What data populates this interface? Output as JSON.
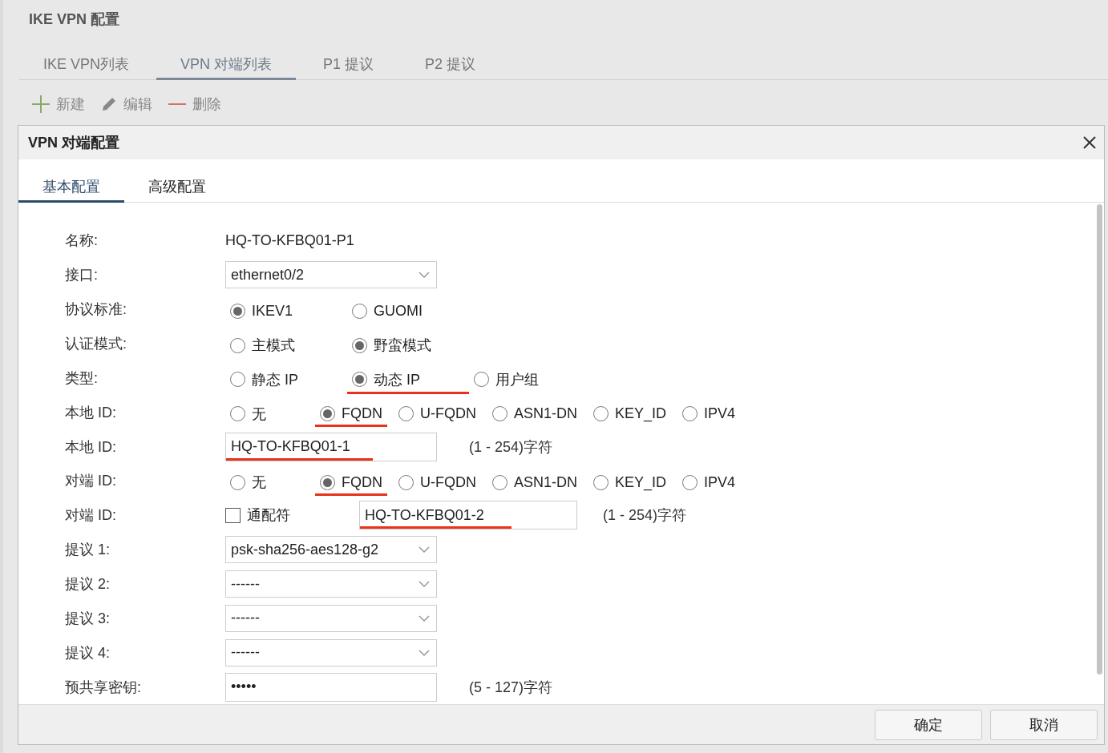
{
  "page_title": "IKE VPN 配置",
  "tabs": [
    {
      "label": "IKE VPN列表",
      "selected": false
    },
    {
      "label": "VPN 对端列表",
      "selected": true
    },
    {
      "label": "P1 提议",
      "selected": false
    },
    {
      "label": "P2 提议",
      "selected": false
    }
  ],
  "toolbar": [
    {
      "kind": "add",
      "label": "新建"
    },
    {
      "kind": "edit",
      "label": "编辑"
    },
    {
      "kind": "delete",
      "label": "删除"
    }
  ],
  "dialog": {
    "title": "VPN 对端配置",
    "tabs": [
      {
        "label": "基本配置",
        "selected": true
      },
      {
        "label": "高级配置",
        "selected": false
      }
    ],
    "rows": [
      {
        "kind": "text",
        "label": "名称:",
        "value": "HQ-TO-KFBQ01-P1"
      },
      {
        "kind": "select",
        "label": "接口:",
        "value": "ethernet0/2"
      },
      {
        "kind": "radio",
        "label": "协议标准:",
        "options": [
          {
            "label": "IKEV1",
            "selected": true,
            "highlighted": false
          },
          {
            "label": "GUOMI",
            "selected": false,
            "highlighted": false
          }
        ]
      },
      {
        "kind": "radio",
        "label": "认证模式:",
        "options": [
          {
            "label": "主模式",
            "selected": false,
            "highlighted": false
          },
          {
            "label": "野蛮模式",
            "selected": true,
            "highlighted": false
          }
        ]
      },
      {
        "kind": "radio",
        "label": "类型:",
        "options": [
          {
            "label": "静态 IP",
            "selected": false,
            "highlighted": false
          },
          {
            "label": "动态 IP",
            "selected": true,
            "highlighted": true
          },
          {
            "label": "用户组",
            "selected": false,
            "highlighted": false
          }
        ]
      },
      {
        "kind": "radio",
        "label": "本地 ID:",
        "options": [
          {
            "label": "无",
            "selected": false,
            "highlighted": false
          },
          {
            "label": "FQDN",
            "selected": true,
            "highlighted": true
          },
          {
            "label": "U-FQDN",
            "selected": false,
            "highlighted": false
          },
          {
            "label": "ASN1-DN",
            "selected": false,
            "highlighted": false
          },
          {
            "label": "KEY_ID",
            "selected": false,
            "highlighted": false
          },
          {
            "label": "IPV4",
            "selected": false,
            "highlighted": false
          }
        ]
      },
      {
        "kind": "input",
        "label": "本地 ID:",
        "value": "HQ-TO-KFBQ01-1",
        "highlighted": true,
        "hint": "(1 - 254)字符"
      },
      {
        "kind": "radio",
        "label": "对端 ID:",
        "options": [
          {
            "label": "无",
            "selected": false,
            "highlighted": false
          },
          {
            "label": "FQDN",
            "selected": true,
            "highlighted": true
          },
          {
            "label": "U-FQDN",
            "selected": false,
            "highlighted": false
          },
          {
            "label": "ASN1-DN",
            "selected": false,
            "highlighted": false
          },
          {
            "label": "KEY_ID",
            "selected": false,
            "highlighted": false
          },
          {
            "label": "IPV4",
            "selected": false,
            "highlighted": false
          }
        ]
      },
      {
        "kind": "wildcard",
        "label": "对端 ID:",
        "checkbox_label": "通配符",
        "checked": false,
        "value": "HQ-TO-KFBQ01-2",
        "highlighted": true,
        "hint": "(1 - 254)字符"
      },
      {
        "kind": "select",
        "label": "提议 1:",
        "value": "psk-sha256-aes128-g2"
      },
      {
        "kind": "select",
        "label": "提议 2:",
        "value": "------"
      },
      {
        "kind": "select",
        "label": "提议 3:",
        "value": "------"
      },
      {
        "kind": "select",
        "label": "提议 4:",
        "value": "------"
      },
      {
        "kind": "password",
        "label": "预共享密钥:",
        "value": "•••••",
        "hint": "(5 - 127)字符"
      }
    ],
    "buttons": [
      "确定",
      "取消"
    ]
  }
}
